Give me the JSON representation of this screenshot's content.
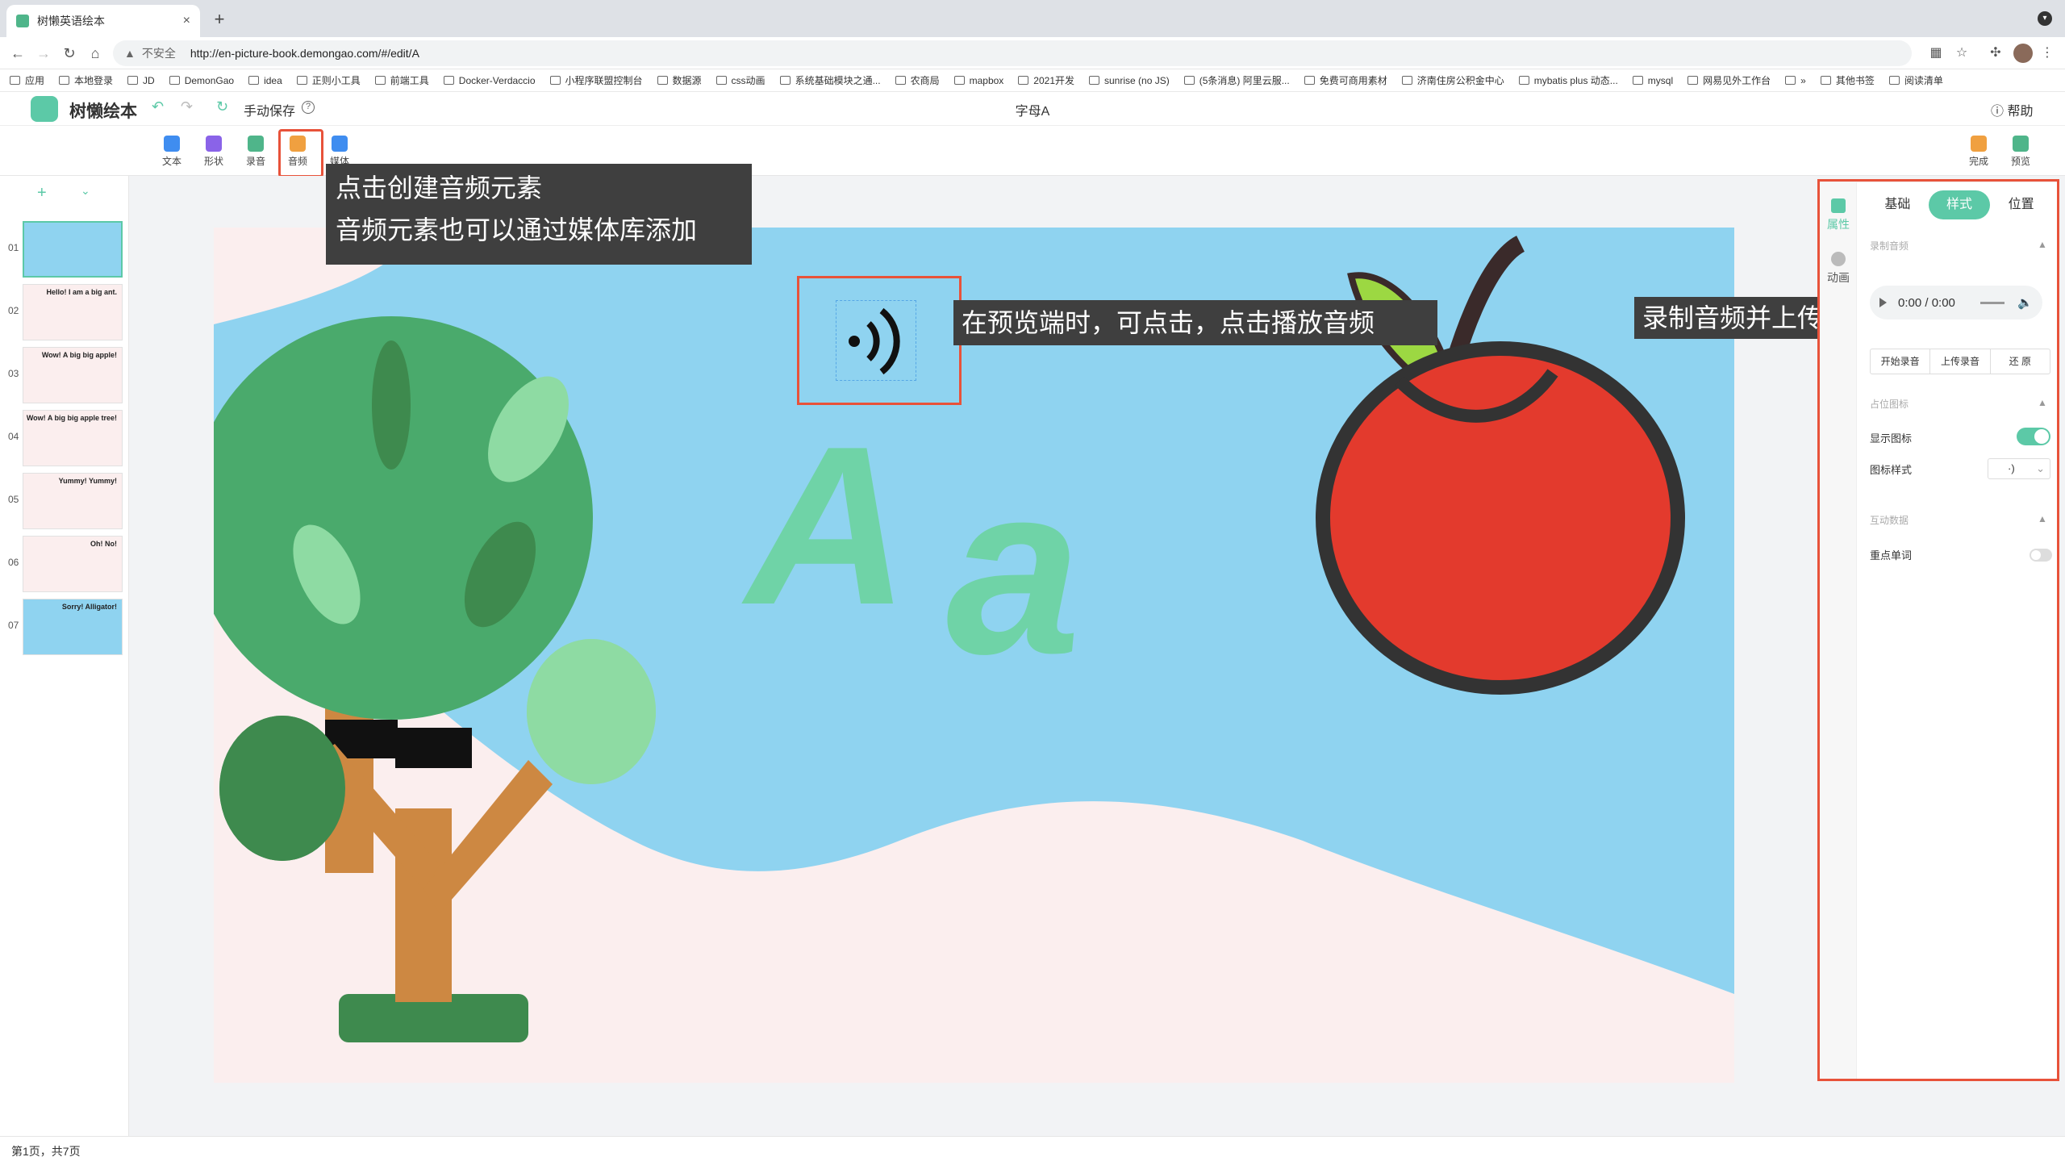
{
  "browser": {
    "tab_title": "树懒英语绘本",
    "url": "http://en-picture-book.demongao.com/#/edit/A",
    "security_warning": "不安全",
    "new_tab": "+",
    "tab_close": "×"
  },
  "bookmarks": [
    "应用",
    "本地登录",
    "JD",
    "DemonGao",
    "idea",
    "正则小工具",
    "前端工具",
    "Docker-Verdaccio",
    "小程序联盟控制台",
    "数据源",
    "css动画",
    "系统基础模块之通...",
    "农商局",
    "mapbox",
    "2021开发",
    "sunrise (no JS)",
    "(5条消息) 阿里云服...",
    "免费可商用素材",
    "济南住房公积金中心",
    "mybatis plus 动态...",
    "mysql",
    "网易见外工作台",
    "»",
    "其他书签",
    "阅读清单"
  ],
  "app": {
    "brand": "树懒绘本",
    "save_mode": "手动保存",
    "doc_title": "字母A",
    "help": "帮助"
  },
  "tools": [
    {
      "label": "文本",
      "color": "#3f8df0"
    },
    {
      "label": "形状",
      "color": "#8a63e8"
    },
    {
      "label": "录音",
      "color": "#4fb58a"
    },
    {
      "label": "音频",
      "color": "#f0a040"
    },
    {
      "label": "媒体",
      "color": "#3f8df0"
    }
  ],
  "actions": {
    "done": "完成",
    "preview": "预览"
  },
  "slides": [
    {
      "num": "01",
      "text": ""
    },
    {
      "num": "02",
      "text": "Hello! I am a big ant."
    },
    {
      "num": "03",
      "text": "Wow! A big big apple!"
    },
    {
      "num": "04",
      "text": "Wow! A big big apple tree!"
    },
    {
      "num": "05",
      "text": "Yummy! Yummy!"
    },
    {
      "num": "06",
      "text": "Oh! No!"
    },
    {
      "num": "07",
      "text": "Sorry! Alligator!"
    }
  ],
  "canvas": {
    "letter_upper": "A",
    "letter_lower": "a"
  },
  "callouts": {
    "c1_line1": "点击创建音频元素",
    "c1_line2": "音频元素也可以通过媒体库添加",
    "c2": "在预览端时，可点击，点击播放音频",
    "c3": "录制音频并上传"
  },
  "panel": {
    "side_tabs": [
      "属性",
      "动画"
    ],
    "tabs": [
      "基础",
      "样式",
      "位置"
    ],
    "active_tab": "样式",
    "section_record": "录制音频",
    "player_time": "0:00 / 0:00",
    "buttons": [
      "开始录音",
      "上传录音",
      "还 原"
    ],
    "section_icon": "占位图标",
    "show_icon_label": "显示图标",
    "show_icon_on": true,
    "icon_style_label": "图标样式",
    "icon_style_value": "·)",
    "section_interact": "互动数据",
    "key_word_label": "重点单词",
    "key_word_on": false
  },
  "status": "第1页，共7页",
  "colors": {
    "accent": "#5cc9a7",
    "highlight": "#e8523a",
    "callout_bg": "#3f3f3f"
  }
}
